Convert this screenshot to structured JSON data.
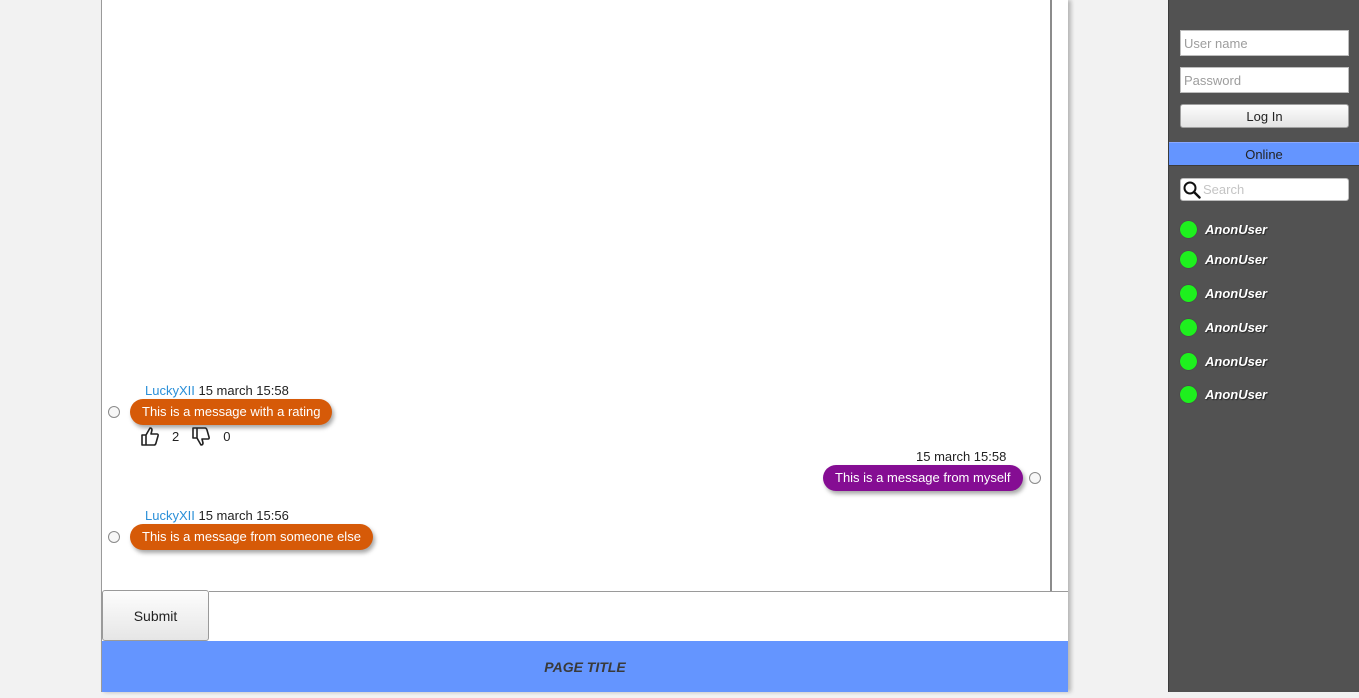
{
  "chat": {
    "messages": [
      {
        "username": "LuckyXII",
        "timestamp": "15 march 15:58",
        "text": "This is a message with a rating",
        "likes": "2",
        "dislikes": "0"
      },
      {
        "username": "",
        "timestamp": "15 march 15:58",
        "text": "This is a message from myself"
      },
      {
        "username": "LuckyXII",
        "timestamp": "15 march 15:56",
        "text": "This is a message from someone else"
      }
    ],
    "colors": {
      "other_bubble": "#d65a08",
      "self_bubble": "#850d93",
      "username": "#2a8fd8"
    }
  },
  "composer": {
    "submit_label": "Submit",
    "input_value": ""
  },
  "footer": {
    "page_title": "PAGE TITLE",
    "accent": "#6495ff"
  },
  "sidebar": {
    "username_placeholder": "User name",
    "password_placeholder": "Password",
    "login_label": "Log In",
    "online_label": "Online",
    "search_placeholder": "Search",
    "users": [
      {
        "name": "AnonUser",
        "status": "online"
      },
      {
        "name": "AnonUser",
        "status": "online"
      },
      {
        "name": "AnonUser",
        "status": "online"
      },
      {
        "name": "AnonUser",
        "status": "online"
      },
      {
        "name": "AnonUser",
        "status": "online"
      },
      {
        "name": "AnonUser",
        "status": "online"
      }
    ],
    "status_color": "#1ef01e"
  }
}
